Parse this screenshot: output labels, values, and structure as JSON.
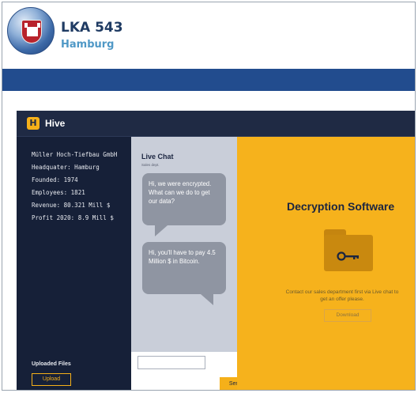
{
  "header": {
    "title": "LKA 543",
    "subtitle": "Hamburg"
  },
  "app": {
    "name": "Hive",
    "logo_letter": "H"
  },
  "company_info": [
    "Müller Hoch-Tiefbau GmbH",
    "Headquater: Hamburg",
    "Founded: 1974",
    "Employees: 1821",
    "Revenue: 80.321 Mill $",
    "Profit 2020: 8.9 Mill $"
  ],
  "uploads": {
    "label": "Uploaded Files",
    "button": "Upload"
  },
  "chat": {
    "title": "Live Chat",
    "subtitle": "Sales dept.",
    "messages": [
      "Hi, we were encrypted. What can we do to get our data?",
      "Hi, you'll have to pay 4.5 Million $ in Bitcoin."
    ],
    "send_label": "Send"
  },
  "ransom": {
    "title": "Decryption Software",
    "contact_text": "Contact our sales department first via Live chat to get an offer please.",
    "download_label": "Download"
  },
  "colors": {
    "accent": "#f6b21c",
    "navy": "#162038",
    "blue_bar": "#224c8e"
  }
}
